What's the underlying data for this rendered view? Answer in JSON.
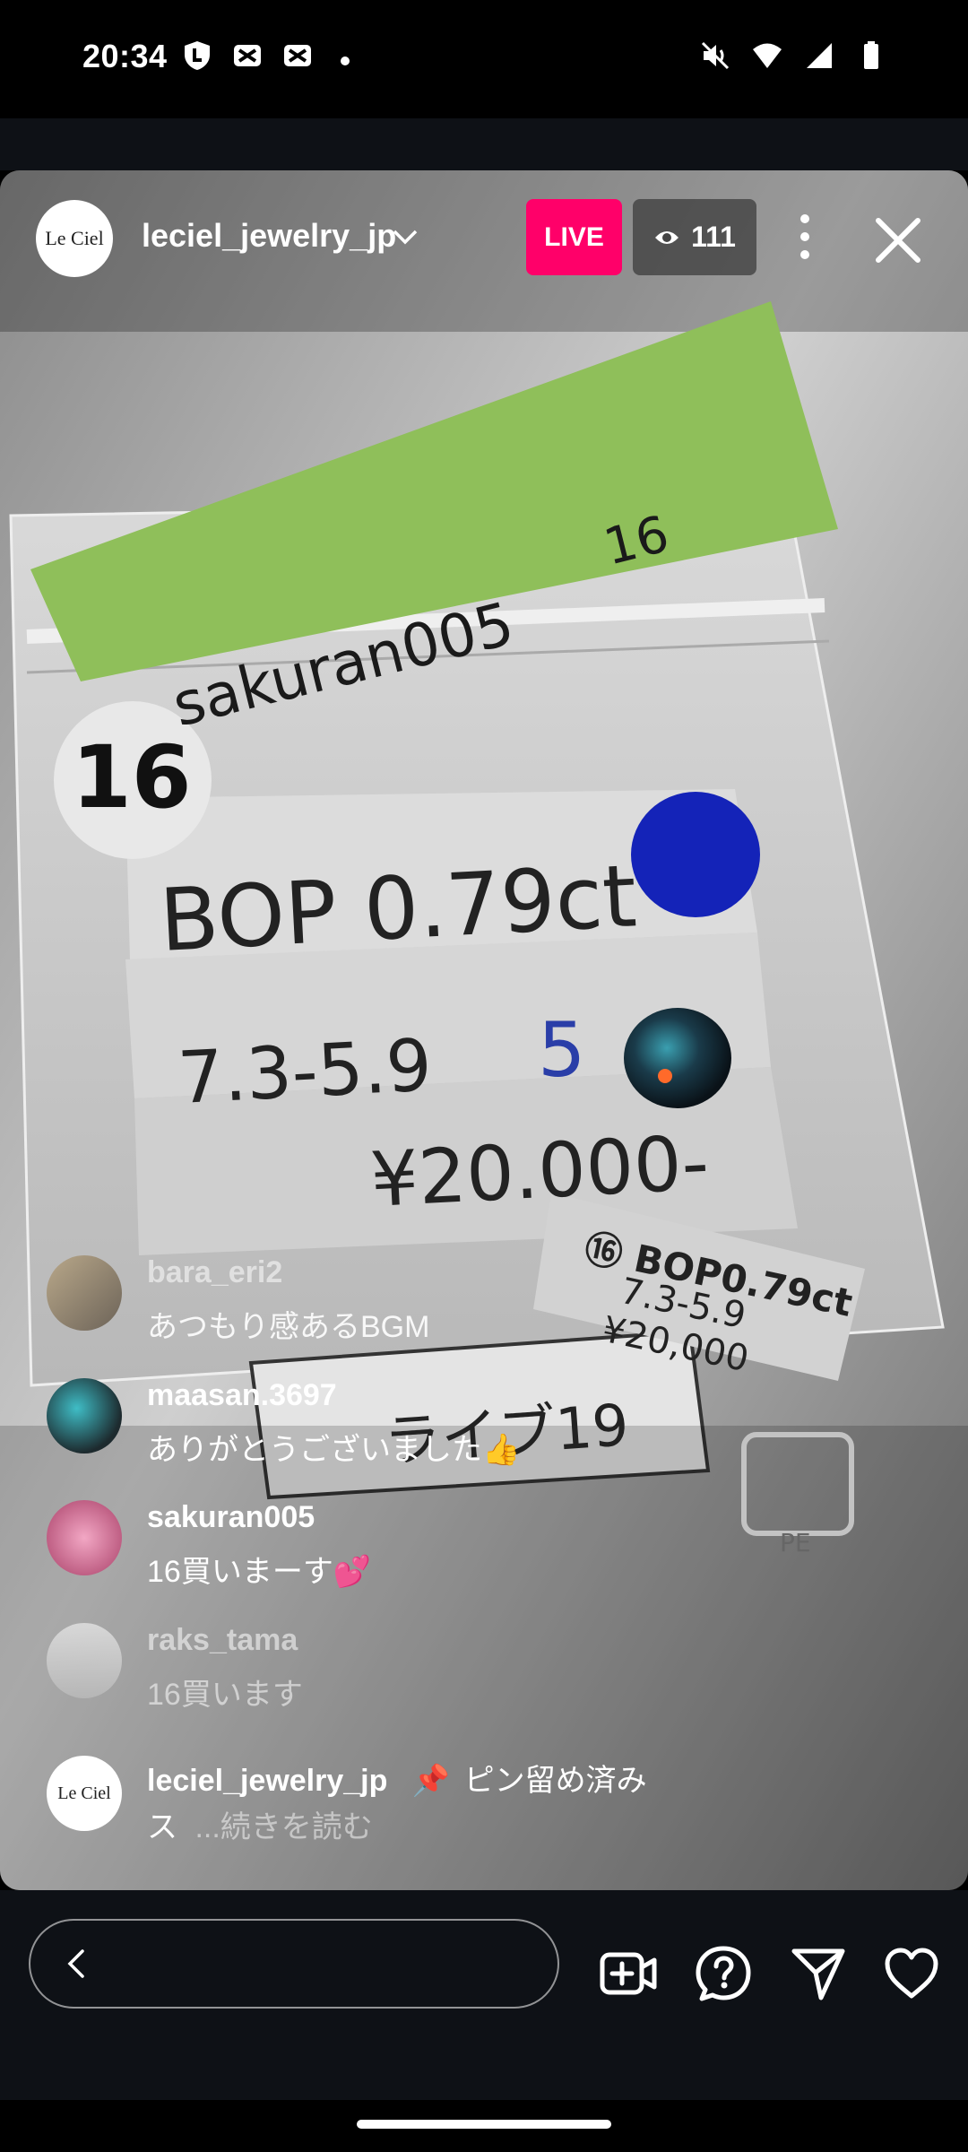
{
  "status_bar": {
    "time": "20:34",
    "left_icons": [
      "shield-l-icon",
      "scissors-box-icon",
      "scissors-box-icon",
      "dot-icon"
    ],
    "right_icons": [
      "mute-icon",
      "wifi-icon",
      "signal-icon",
      "battery-icon"
    ]
  },
  "live": {
    "host_username": "leciel_jewelry_jp",
    "host_avatar_text": "Le Ciel",
    "live_label": "LIVE",
    "viewer_count": "111",
    "accent": "#ff0069"
  },
  "scene_text": {
    "tag_text": "sakuran005",
    "tag_number": "16",
    "badge_number": "16",
    "line1": "BOP 0.79ct",
    "line2": "7.3-5.9",
    "line2_extra": "5",
    "line3": "¥20.000-",
    "sticker_line1": "⑯ BOP0.79ct",
    "sticker_line2": "7.3-5.9",
    "sticker_line3": "¥20,000",
    "lower_label": "ライブ19",
    "logo_text": "PE"
  },
  "comments": [
    {
      "username": "bara_eri2",
      "text": "あつもり感あるBGM"
    },
    {
      "username": "maasan.3697",
      "text": "ありがとうございました👍"
    },
    {
      "username": "sakuran005",
      "text": "16買いまーす💕"
    },
    {
      "username": "raks_tama",
      "text": "16買います"
    },
    {
      "username": "leciel_jewelry_jp",
      "pinned_label": "ピン留め済み",
      "text_start": "ス",
      "read_more": "...続きを読む"
    }
  ],
  "bottom_bar": {
    "icons": [
      "add-video-icon",
      "question-icon",
      "send-icon",
      "heart-icon"
    ]
  }
}
